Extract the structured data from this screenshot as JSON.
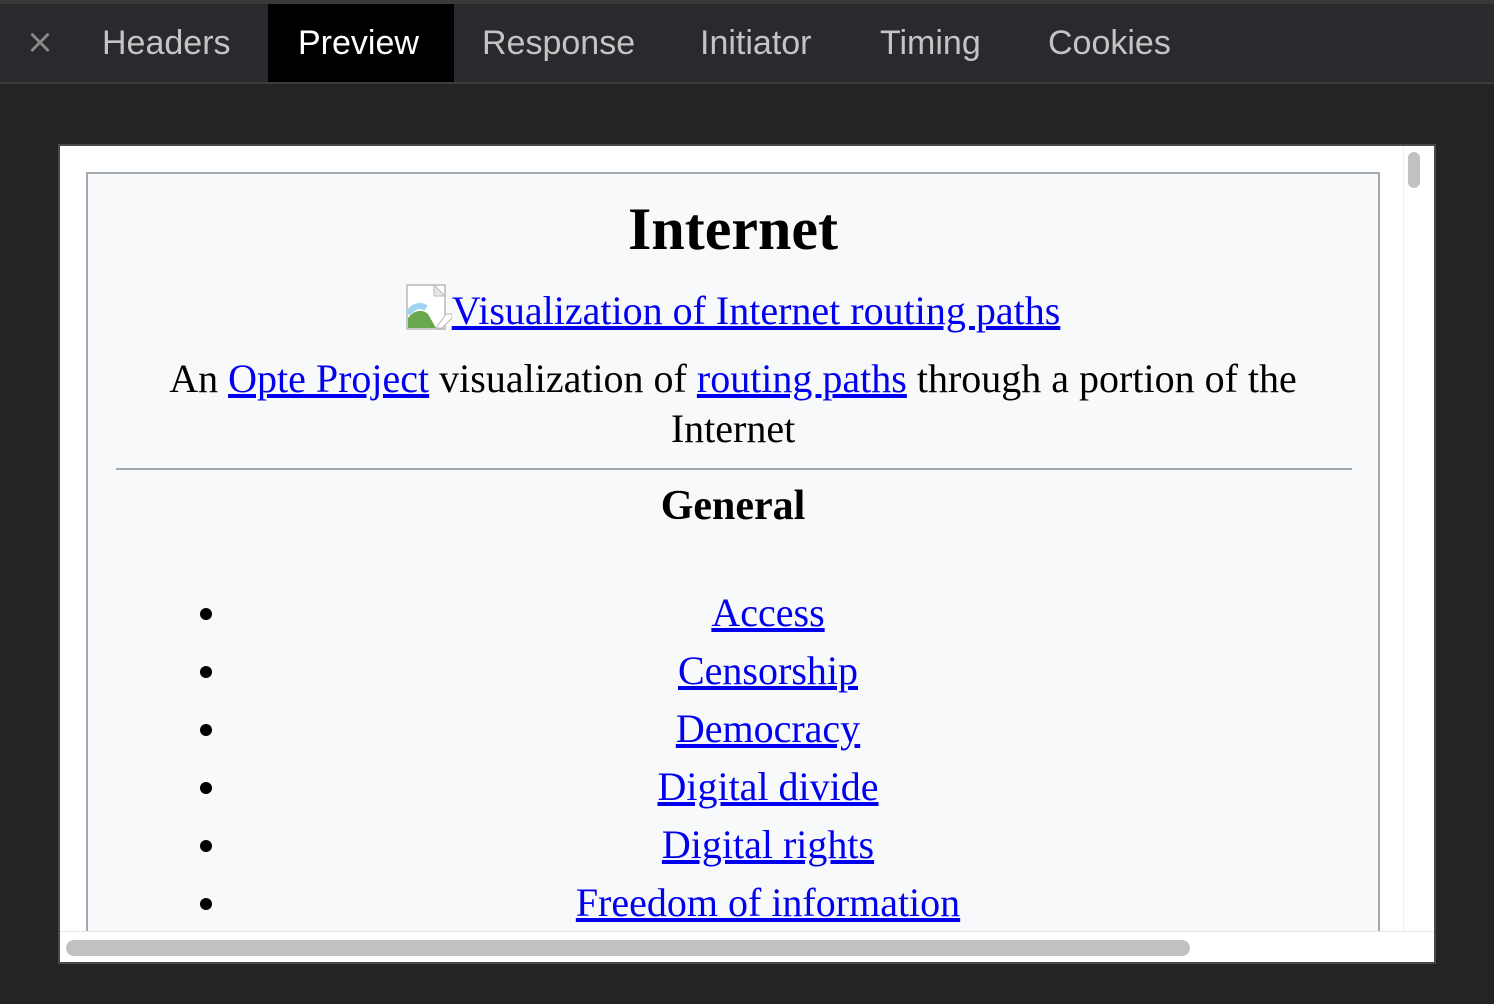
{
  "tabs": {
    "close_symbol": "×",
    "items": [
      {
        "label": "Headers",
        "active": false
      },
      {
        "label": "Preview",
        "active": true
      },
      {
        "label": "Response",
        "active": false
      },
      {
        "label": "Initiator",
        "active": false
      },
      {
        "label": "Timing",
        "active": false
      },
      {
        "label": "Cookies",
        "active": false
      }
    ]
  },
  "infobox": {
    "title": "Internet",
    "image_link": "Visualization of Internet routing paths",
    "caption": {
      "prefix": "An ",
      "link1": "Opte Project",
      "middle": " visualization of ",
      "link2": "routing paths",
      "suffix": " through a portion of the Internet"
    },
    "section_title": "General",
    "list": [
      "Access",
      "Censorship",
      "Democracy",
      "Digital divide",
      "Digital rights",
      "Freedom of information"
    ]
  },
  "colors": {
    "link": "#0000ee",
    "infobox_bg": "#f8f9fa",
    "infobox_border": "#a2a9b1",
    "devtools_bg": "#242424",
    "active_tab_bg": "#000000"
  },
  "icons": {
    "close": "close-icon",
    "broken_image": "broken-image-icon"
  }
}
